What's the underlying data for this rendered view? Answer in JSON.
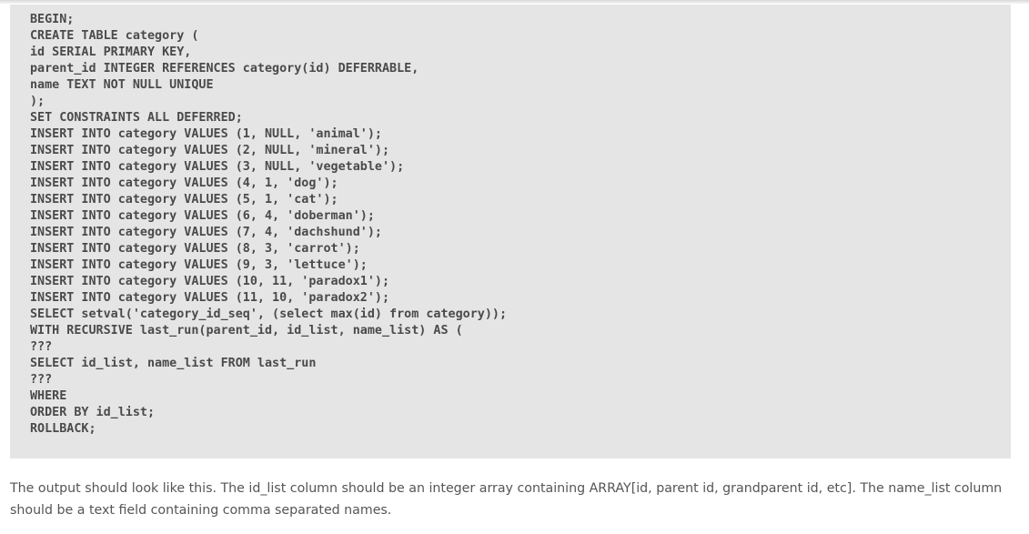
{
  "code": {
    "lines": [
      "BEGIN;",
      "CREATE TABLE category (",
      "id SERIAL PRIMARY KEY,",
      "parent_id INTEGER REFERENCES category(id) DEFERRABLE,",
      "name TEXT NOT NULL UNIQUE",
      ");",
      "SET CONSTRAINTS ALL DEFERRED;",
      "INSERT INTO category VALUES (1, NULL, 'animal');",
      "INSERT INTO category VALUES (2, NULL, 'mineral');",
      "INSERT INTO category VALUES (3, NULL, 'vegetable');",
      "INSERT INTO category VALUES (4, 1, 'dog');",
      "INSERT INTO category VALUES (5, 1, 'cat');",
      "INSERT INTO category VALUES (6, 4, 'doberman');",
      "INSERT INTO category VALUES (7, 4, 'dachshund');",
      "INSERT INTO category VALUES (8, 3, 'carrot');",
      "INSERT INTO category VALUES (9, 3, 'lettuce');",
      "INSERT INTO category VALUES (10, 11, 'paradox1');",
      "INSERT INTO category VALUES (11, 10, 'paradox2');",
      "SELECT setval('category_id_seq', (select max(id) from category));",
      "WITH RECURSIVE last_run(parent_id, id_list, name_list) AS (",
      "???",
      "SELECT id_list, name_list FROM last_run",
      "???",
      "WHERE",
      "ORDER BY id_list;",
      "ROLLBACK;"
    ]
  },
  "description": {
    "text": "The output should look like this. The id_list column should be an integer array containing ARRAY[id, parent id, grandparent id, etc]. The name_list column should be a text field containing comma separated names."
  },
  "colors": {
    "code_background": "#e5e5e5",
    "code_text": "#4a4a4a",
    "body_text": "#555555"
  }
}
